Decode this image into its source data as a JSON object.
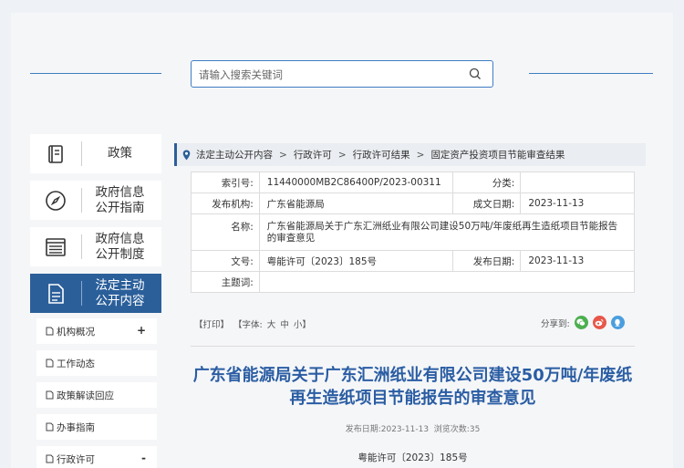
{
  "search": {
    "placeholder": "请输入搜索关键词"
  },
  "nav": [
    {
      "label": "政策",
      "icon": "book-icon",
      "active": false
    },
    {
      "label": "政府信息公开指南",
      "line1": "政府信息",
      "line2": "公开指南",
      "icon": "compass-icon",
      "active": false
    },
    {
      "label": "政府信息公开制度",
      "line1": "政府信息",
      "line2": "公开制度",
      "icon": "list-icon",
      "active": false
    },
    {
      "label": "法定主动公开内容",
      "line1": "法定主动",
      "line2": "公开内容",
      "icon": "document-icon",
      "active": true
    }
  ],
  "subnav": [
    {
      "label": "机构概况",
      "toggle": "+"
    },
    {
      "label": "工作动态",
      "toggle": ""
    },
    {
      "label": "政策解读回应",
      "toggle": ""
    },
    {
      "label": "办事指南",
      "toggle": ""
    },
    {
      "label": "行政许可",
      "toggle": "-"
    }
  ],
  "breadcrumb": [
    "法定主动公开内容",
    "行政许可",
    "行政许可结果",
    "固定资产投资项目节能审查结果"
  ],
  "meta": {
    "index_label": "索引号:",
    "index_value": "11440000MB2C86400P/2023-00311",
    "category_label": "分类:",
    "category_value": "",
    "publisher_label": "发布机构:",
    "publisher_value": "广东省能源局",
    "created_label": "成文日期:",
    "created_value": "2023-11-13",
    "name_label": "名称:",
    "name_value": "广东省能源局关于广东汇洲纸业有限公司建设50万吨/年废纸再生造纸项目节能报告的审查意见",
    "docno_label": "文号:",
    "docno_value": "粤能许可〔2023〕185号",
    "published_label": "发布日期:",
    "published_value": "2023-11-13",
    "subject_label": "主题词:",
    "subject_value": ""
  },
  "toolbar": {
    "print": "【打印】",
    "font": "【字体:",
    "large": "大",
    "medium": "中",
    "small": "小】",
    "share": "分享到:"
  },
  "article": {
    "title": "广东省能源局关于广东汇洲纸业有限公司建设50万吨/年废纸再生造纸项目节能报告的审查意见",
    "pubdate_label": "发布日期:",
    "pubdate": "2023-11-13",
    "views_label": "浏览次数:",
    "views": "35",
    "docno": "粤能许可〔2023〕185号"
  },
  "colors": {
    "accent": "#2b5f9a",
    "title": "#2a5da3",
    "wechat": "#4caf50",
    "weibo": "#e8564a",
    "qq": "#4a9ede"
  }
}
